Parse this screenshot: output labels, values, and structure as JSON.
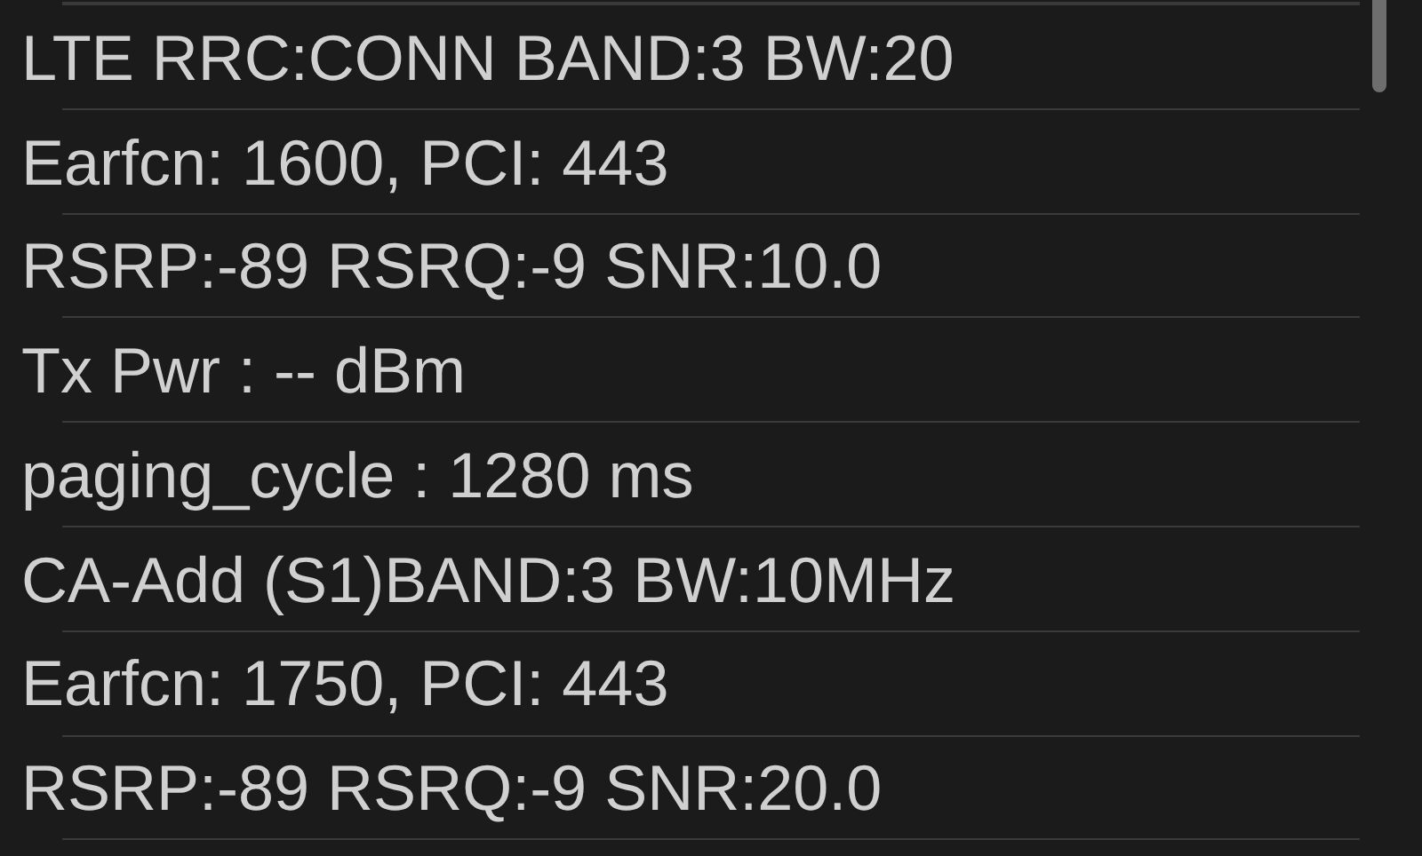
{
  "lines": [
    {
      "text": "LTE RRC:CONN BAND:3 BW:20"
    },
    {
      "text": "Earfcn: 1600, PCI: 443"
    },
    {
      "text": "RSRP:-89 RSRQ:-9 SNR:10.0"
    },
    {
      "text": "Tx Pwr : -- dBm"
    },
    {
      "text": "paging_cycle : 1280 ms"
    },
    {
      "text": "CA-Add (S1)BAND:3 BW:10MHz"
    },
    {
      "text": "Earfcn: 1750, PCI: 443"
    },
    {
      "text": "RSRP:-89 RSRQ:-9 SNR:20.0"
    }
  ]
}
